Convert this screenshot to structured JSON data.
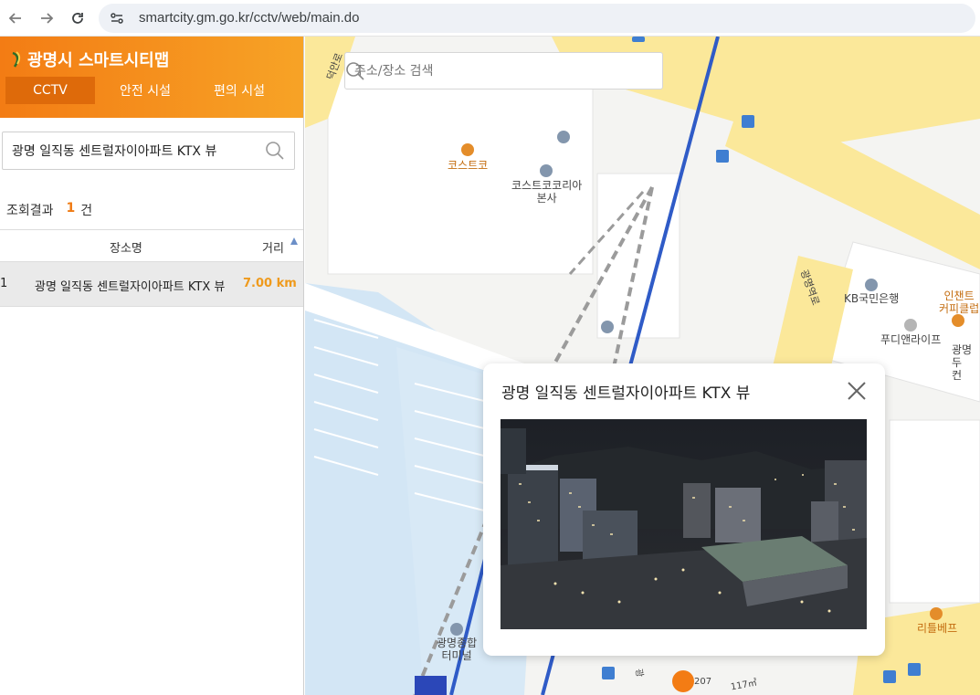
{
  "browser": {
    "url": "smartcity.gm.go.kr/cctv/web/main.do"
  },
  "sidebar": {
    "title": "광명시 스마트시티맵",
    "tabs": [
      {
        "label": "CCTV",
        "active": true
      },
      {
        "label": "안전 시설",
        "active": false
      },
      {
        "label": "편의 시설",
        "active": false
      }
    ],
    "search_value": "광명 일직동 센트럴자이아파트 KTX 뷰",
    "result_label": "조회결과",
    "result_count": "1",
    "result_unit": "건",
    "table": {
      "headers": {
        "name": "장소명",
        "distance": "거리"
      },
      "rows": [
        {
          "index": "1",
          "name": "광명 일직동 센트럴자이아파트 KTX 뷰",
          "distance": "7.00 km"
        }
      ]
    }
  },
  "map": {
    "search_placeholder": "주소/장소 검색",
    "labels": {
      "costco": "코스트코",
      "costco_hq_line1": "코스트코코리아",
      "costco_hq_line2": "본사",
      "kb_bank": "KB국민은행",
      "foodie": "푸디앤라이프",
      "interchange_line1": "인챈트",
      "interchange_line2": "커피클럽",
      "gwangmyeong_cut_line1": "광명두",
      "gwangmyeong_cut_line2": "컨",
      "terminal_line1": "광명종합",
      "terminal_line2": "터미널",
      "little_bepe": "리틀베프",
      "road_duk": "덕안로",
      "road_gwangmyeong": "광명역로",
      "dist_207": "207",
      "dist_117": "117㎡",
      "gwang_cut": "광"
    },
    "colors": {
      "road_yellow": "#fbe89a",
      "rail_blue": "#2f5bc7",
      "water_blue": "#d3e6f5",
      "brand_orange": "#f37c14"
    }
  },
  "popup": {
    "title": "광명 일직동 센트럴자이아파트 KTX 뷰"
  }
}
